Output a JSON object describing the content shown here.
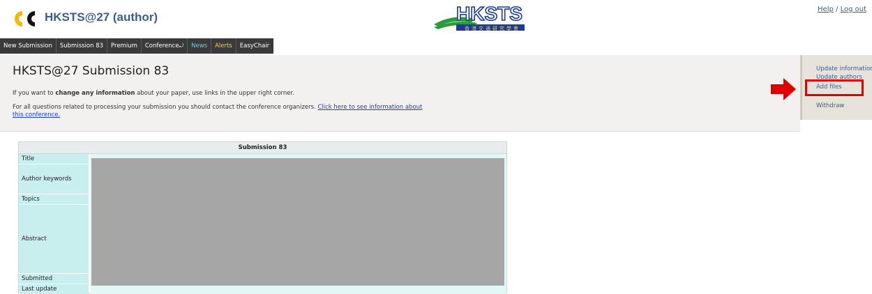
{
  "header": {
    "app_title": "HKSTS@27 (author)",
    "logo_text": "HKSTS",
    "logo_subtext": "香港交通研究學會",
    "help_link": "Help",
    "separator": "/",
    "logout_link": "Log out"
  },
  "menu": {
    "items": [
      {
        "label": "New Submission"
      },
      {
        "label": "Submission 83"
      },
      {
        "label": "Premium"
      },
      {
        "label": "Conference"
      },
      {
        "label": "News"
      },
      {
        "label": "Alerts"
      },
      {
        "label": "EasyChair"
      }
    ]
  },
  "main": {
    "page_title": "HKSTS@27 Submission 83",
    "info_line1_prefix": "If you want to ",
    "info_line1_bold": "change any information",
    "info_line1_suffix": " about your paper, use links in the upper right corner.",
    "info_line2_prefix": "For all questions related to processing your submission you should contact the conference organizers. ",
    "info_line2_link": "Click here to see information about this conference."
  },
  "actions": {
    "update_information": "Update information",
    "update_authors": "Update authors",
    "add_files": "Add files",
    "withdraw": "Withdraw"
  },
  "submission_table": {
    "header": "Submission 83",
    "rows": [
      {
        "label": "Title"
      },
      {
        "label": "Author keywords"
      },
      {
        "label": "Topics"
      },
      {
        "label": "Abstract"
      },
      {
        "label": "Submitted"
      },
      {
        "label": "Last update"
      }
    ]
  },
  "colors": {
    "menu_bg": "#3a3a3a",
    "news": "#60d4e8",
    "alerts": "#f4d03f",
    "highlight": "#e00000",
    "label_bg": "#c8eeee",
    "redacted": "#a6a6a6"
  }
}
